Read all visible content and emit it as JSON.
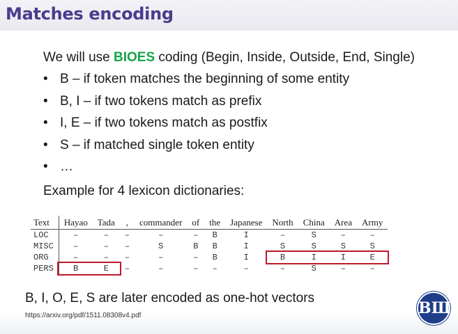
{
  "slide": {
    "title": "Matches encoding",
    "intro_pre": "We will use ",
    "intro_highlight": "BIOES",
    "intro_post": " coding (Begin, Inside, Outside, End, Single)",
    "bullets": [
      "B – if token matches the beginning of some entity",
      "B, I – if two tokens match as prefix",
      "I, E – if two tokens match as postfix",
      "S – if matched single token entity",
      "…"
    ],
    "example_label": "Example for 4 lexicon dictionaries:",
    "bottom_text": "B, I, O, E, S are later encoded as one-hot vectors",
    "source_url": "https://arxiv.org/pdf/1511.08308v4.pdf",
    "logo_text": "ВШ"
  },
  "table": {
    "headers": [
      "Text",
      "Hayao",
      "Tada",
      ",",
      "commander",
      "of",
      "the",
      "Japanese",
      "North",
      "China",
      "Area",
      "Army"
    ],
    "rows": [
      [
        "LOC",
        "–",
        "–",
        "–",
        "–",
        "–",
        "B",
        "I",
        "–",
        "S",
        "–",
        "–"
      ],
      [
        "MISC",
        "–",
        "–",
        "–",
        "S",
        "B",
        "B",
        "I",
        "S",
        "S",
        "S",
        "S"
      ],
      [
        "ORG",
        "–",
        "–",
        "–",
        "–",
        "–",
        "B",
        "I",
        "B",
        "I",
        "I",
        "E"
      ],
      [
        "PERS",
        "B",
        "E",
        "–",
        "–",
        "–",
        "–",
        "–",
        "–",
        "S",
        "–",
        "–"
      ]
    ]
  },
  "colors": {
    "title": "#4a3c8c",
    "highlight": "#17a34a",
    "box": "#c0182b",
    "logo": "#1f3e8a"
  }
}
